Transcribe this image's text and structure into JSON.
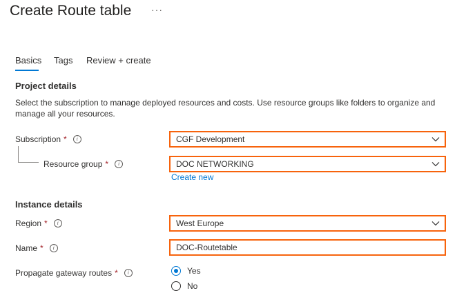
{
  "page": {
    "title": "Create Route table",
    "more_label": "···"
  },
  "tabs": [
    {
      "label": "Basics",
      "active": true
    },
    {
      "label": "Tags",
      "active": false
    },
    {
      "label": "Review + create",
      "active": false
    }
  ],
  "project_details": {
    "heading": "Project details",
    "description": "Select the subscription to manage deployed resources and costs. Use resource groups like folders to organize and manage all your resources.",
    "subscription": {
      "label": "Subscription",
      "required": "*",
      "value": "CGF Development"
    },
    "resource_group": {
      "label": "Resource group",
      "required": "*",
      "value": "DOC NETWORKING",
      "create_new": "Create new"
    }
  },
  "instance_details": {
    "heading": "Instance details",
    "region": {
      "label": "Region",
      "required": "*",
      "value": "West Europe"
    },
    "name": {
      "label": "Name",
      "required": "*",
      "value": "DOC-Routetable"
    },
    "propagate": {
      "label": "Propagate gateway routes",
      "required": "*",
      "options": [
        "Yes",
        "No"
      ],
      "selected": "Yes"
    }
  },
  "colors": {
    "accent": "#0078d4",
    "highlight_border": "#f7630c",
    "required": "#a4262c"
  },
  "icons": {
    "info": "info-icon",
    "dropdown": "chevron-down-icon"
  }
}
